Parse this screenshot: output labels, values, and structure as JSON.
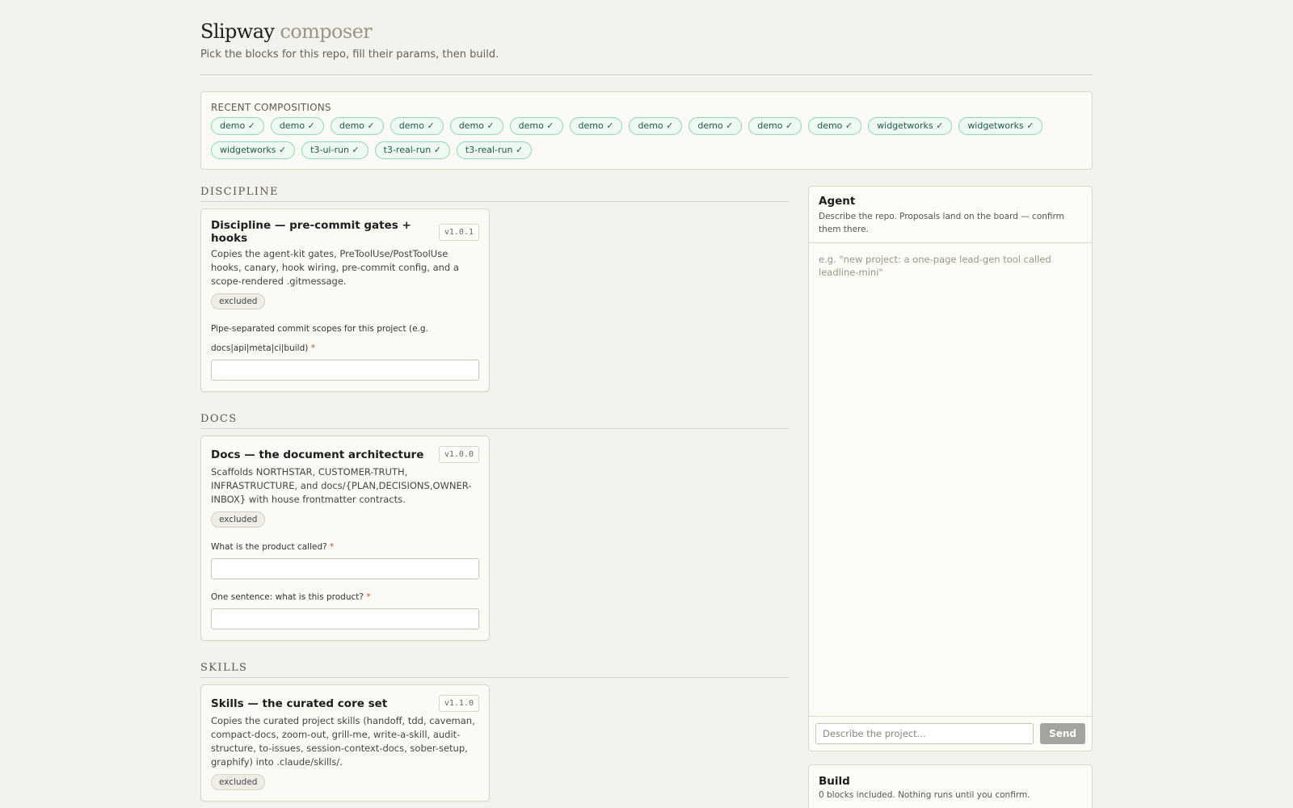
{
  "header": {
    "title": "Slipway",
    "title_sub": "composer",
    "subtitle": "Pick the blocks for this repo, fill their params, then build."
  },
  "recent": {
    "label": "RECENT COMPOSITIONS",
    "chips": [
      "demo ✓",
      "demo ✓",
      "demo ✓",
      "demo ✓",
      "demo ✓",
      "demo ✓",
      "demo ✓",
      "demo ✓",
      "demo ✓",
      "demo ✓",
      "demo ✓",
      "widgetworks ✓",
      "widgetworks ✓",
      "widgetworks ✓",
      "t3-ui-run ✓",
      "t3-real-run ✓",
      "t3-real-run ✓"
    ]
  },
  "sections": {
    "discipline": {
      "title": "DISCIPLINE",
      "card": {
        "title": "Discipline — pre-commit gates + hooks",
        "version": "v1.0.1",
        "description": "Copies the agent-kit gates, PreToolUse/PostToolUse hooks, canary, hook wiring, pre-commit config, and a scope-rendered .gitmessage.",
        "badge": "excluded",
        "field_label_1": "Pipe-separated commit scopes for this project (e.g.",
        "field_label_2": "docs|api|meta|ci|build)",
        "required": "*"
      }
    },
    "docs": {
      "title": "DOCS",
      "card": {
        "title": "Docs — the document architecture",
        "version": "v1.0.0",
        "description": "Scaffolds NORTHSTAR, CUSTOMER-TRUTH, INFRASTRUCTURE, and docs/{PLAN,DECISIONS,OWNER-INBOX} with house frontmatter contracts.",
        "badge": "excluded",
        "field_1_label": "What is the product called?",
        "field_2_label": "One sentence: what is this product?",
        "required": "*"
      }
    },
    "skills": {
      "title": "SKILLS",
      "card": {
        "title": "Skills — the curated core set",
        "version": "v1.1.0",
        "description": "Copies the curated project skills (handoff, tdd, caveman, compact-docs, zoom-out, grill-me, write-a-skill, audit-structure, to-issues, session-context-docs, sober-setup, graphify) into .claude/skills/.",
        "badge": "excluded"
      }
    }
  },
  "agent": {
    "title": "Agent",
    "description": "Describe the repo. Proposals land on the board — confirm them there.",
    "log_placeholder": "e.g. \"new project: a one-page lead-gen tool called leadline-mini\"",
    "input_placeholder": "Describe the project...",
    "send_label": "Send"
  },
  "build": {
    "title": "Build",
    "description": "0 blocks included. Nothing runs until you confirm."
  }
}
